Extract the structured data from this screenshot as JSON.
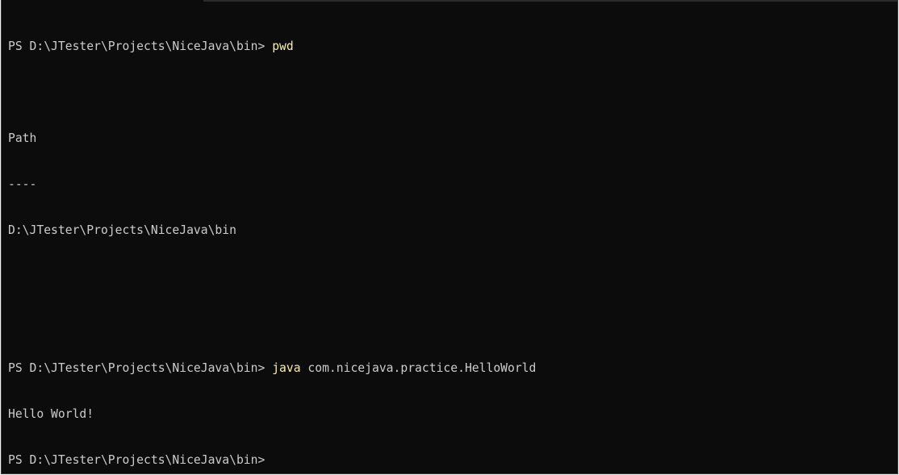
{
  "terminal": {
    "prompt1": "PS D:\\JTester\\Projects\\NiceJava\\bin> ",
    "cmd1": "pwd",
    "out_header": "Path",
    "out_rule": "----",
    "out_path": "D:\\JTester\\Projects\\NiceJava\\bin",
    "prompt2": "PS D:\\JTester\\Projects\\NiceJava\\bin> ",
    "cmd2_name": "java",
    "cmd2_args": " com.nicejava.practice.HelloWorld",
    "out_hello": "Hello World!",
    "prompt3": "PS D:\\JTester\\Projects\\NiceJava\\bin> "
  },
  "colors": {
    "background": "#0c0c0c",
    "text": "#cccccc",
    "command": "#f9f1a5"
  }
}
